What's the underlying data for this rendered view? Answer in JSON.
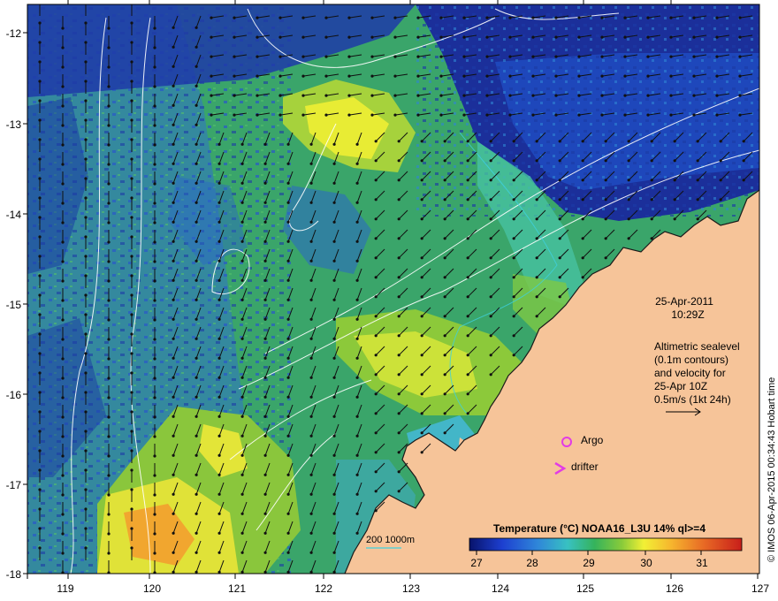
{
  "map": {
    "date": "25-Apr-2011",
    "time": "10:29Z",
    "altimetry_lines": [
      "Altimetric sealevel",
      "(0.1m contours)",
      "and velocity for",
      "25-Apr 10Z",
      "0.5m/s (1kt 24h)"
    ],
    "legend_argo": "Argo",
    "legend_drifter": "drifter",
    "bathy_label": "200  1000m",
    "colorbar_title": "Temperature (°C) NOAA16_L3U 14% ql>=4",
    "colorbar_ticks": [
      "27",
      "28",
      "29",
      "30",
      "31"
    ],
    "credit": "© IMOS 06-Apr-2015 00:34:43 Hobart time",
    "x_ticks": [
      "119",
      "120",
      "121",
      "122",
      "123",
      "124",
      "125",
      "126",
      "127"
    ],
    "y_ticks": [
      "-12",
      "-13",
      "-14",
      "-15",
      "-16",
      "-17",
      "-18"
    ],
    "colors": {
      "land": "#f6c499",
      "argo_marker": "#e23be6",
      "drifter_marker": "#e23be6",
      "bathy_contour": "#3fd1e0"
    }
  }
}
